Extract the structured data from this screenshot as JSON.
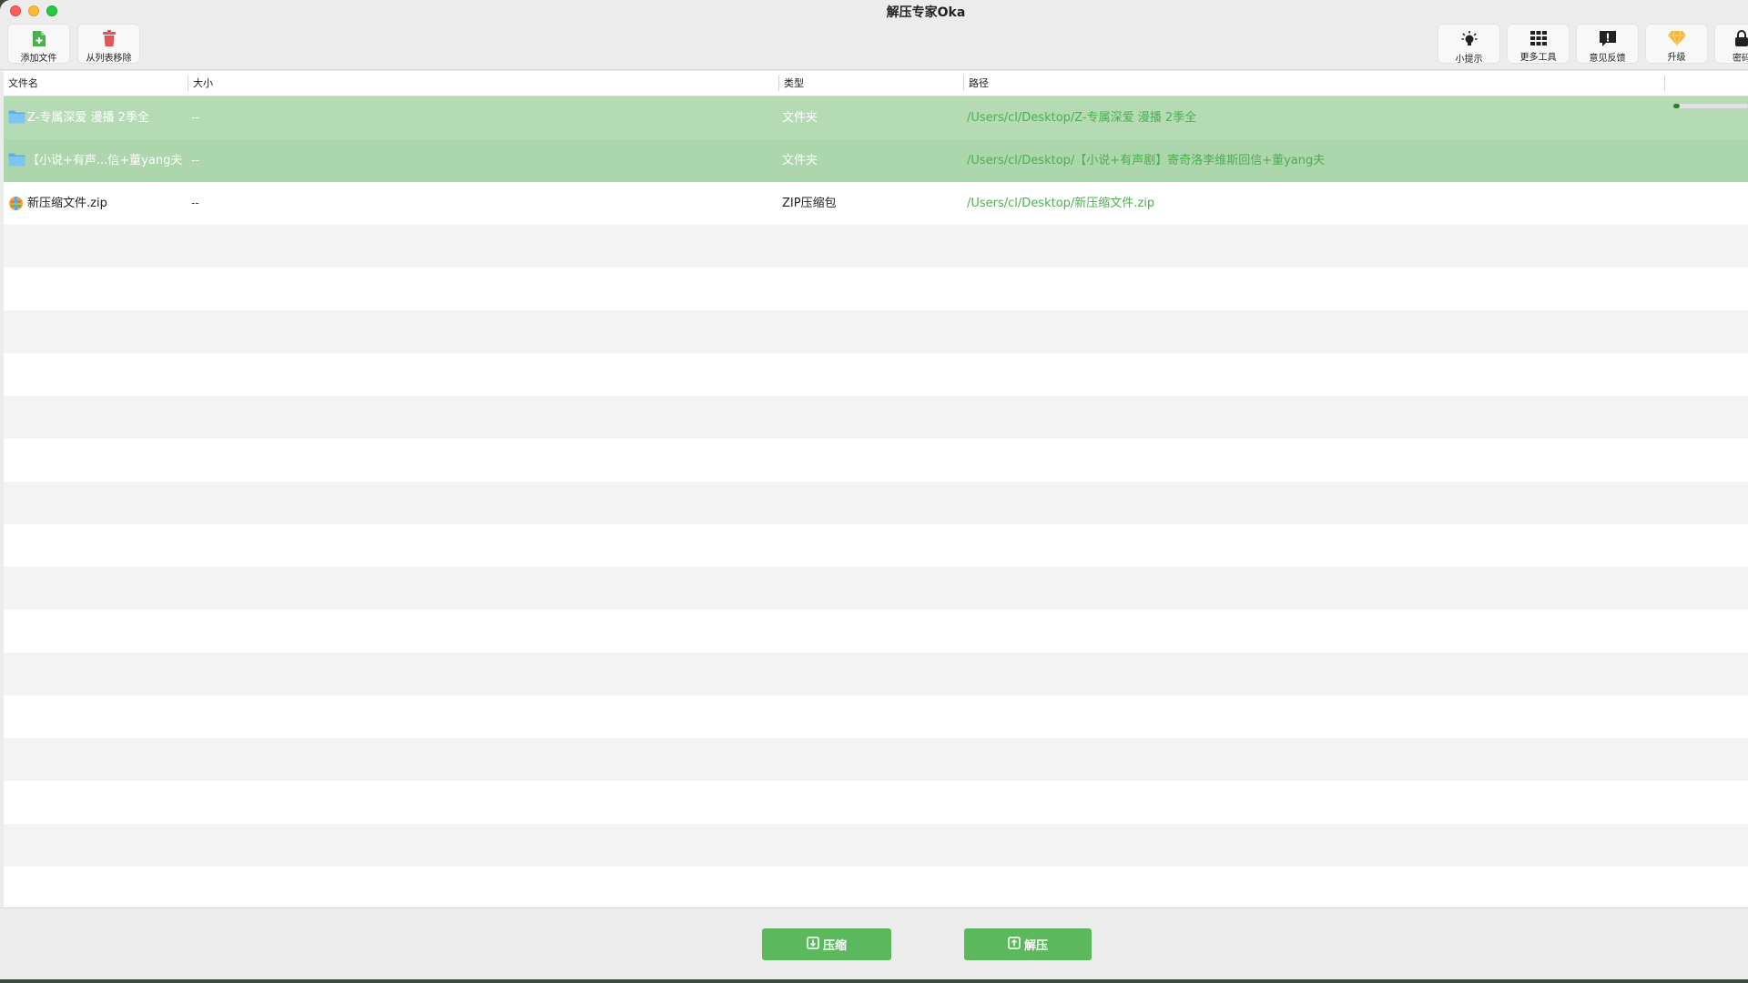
{
  "window": {
    "title": "解压专家Oka"
  },
  "toolbar": {
    "left": [
      {
        "id": "add",
        "label": "添加文件",
        "icon": "add-file-icon",
        "color": "#4caf50"
      },
      {
        "id": "remove",
        "label": "从列表移除",
        "icon": "trash-icon",
        "color": "#e05555"
      }
    ],
    "right": [
      {
        "id": "tips",
        "label": "小提示",
        "icon": "lightbulb-icon"
      },
      {
        "id": "tools",
        "label": "更多工具",
        "icon": "grid-icon"
      },
      {
        "id": "feedback",
        "label": "意见反馈",
        "icon": "feedback-icon"
      },
      {
        "id": "upgrade",
        "label": "升级",
        "icon": "diamond-icon",
        "color": "#f5b63c"
      },
      {
        "id": "password",
        "label": "密码",
        "icon": "lock-icon"
      }
    ]
  },
  "table": {
    "columns": {
      "name": "文件名",
      "size": "大小",
      "type": "类型",
      "path": "路径"
    },
    "rows": [
      {
        "name": "Z-专属深爱 漫播 2季全",
        "size": "--",
        "type": "文件夹",
        "path": "/Users/cl/Desktop/Z-专属深爱 漫播 2季全",
        "icon": "folder-icon",
        "selected": true
      },
      {
        "name": "【小说+有声...信+董yang夫",
        "size": "--",
        "type": "文件夹",
        "path": "/Users/cl/Desktop/【小说+有声剧】寄奇洛李维斯回信+董yang夫",
        "icon": "folder-icon",
        "selected": true
      },
      {
        "name": "新压缩文件.zip",
        "size": "--",
        "type": "ZIP压缩包",
        "path": "/Users/cl/Desktop/新压缩文件.zip",
        "icon": "zip-archive-icon",
        "selected": false,
        "progress": 0.08
      }
    ],
    "empty_rows": 16
  },
  "footer": {
    "compress_label": "压缩",
    "extract_label": "解压",
    "accent": "#5cb85c"
  },
  "colors": {
    "selected_row": "#b5dbb5",
    "path_text": "#4caf50"
  }
}
